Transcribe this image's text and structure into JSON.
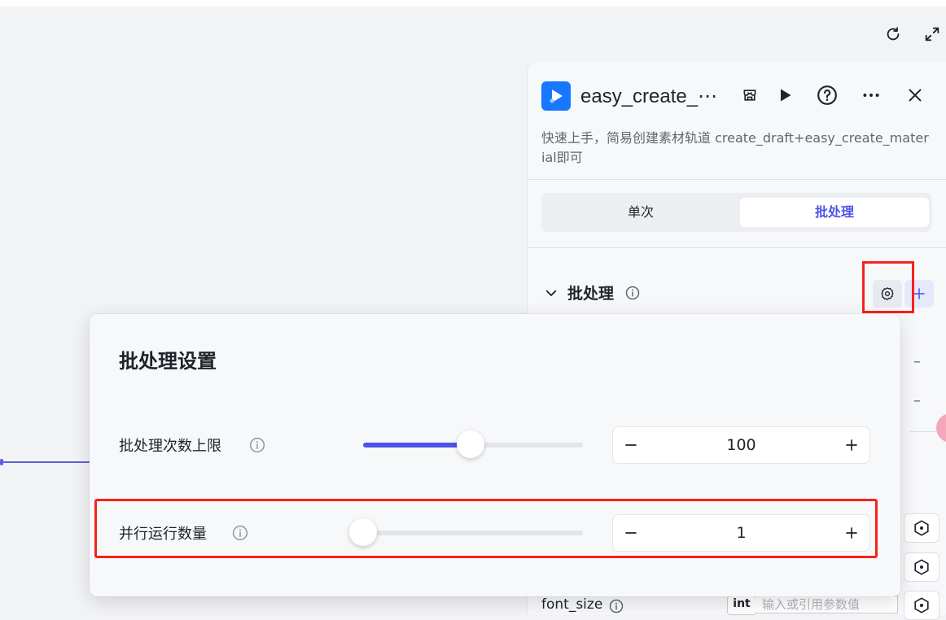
{
  "toolbar": {
    "refresh_icon": "refresh-icon",
    "fullscreen_icon": "expand-icon"
  },
  "panel": {
    "title": "easy_create_⋯",
    "description": "快速上手，简易创建素材轨道 create_draft+easy_create_material即可",
    "tabs": [
      {
        "label": "单次",
        "active": false
      },
      {
        "label": "批处理",
        "active": true
      }
    ],
    "section": {
      "title": "批处理"
    },
    "field": {
      "label": "font_size",
      "type_badge": "int",
      "placeholder": "输入或引用参数值"
    }
  },
  "popover": {
    "title": "批处理设置",
    "rows": [
      {
        "label": "批处理次数上限",
        "value": "100",
        "slider_fraction": 0.49
      },
      {
        "label": "并行运行数量",
        "value": "1",
        "slider_fraction": 0.0
      }
    ]
  },
  "colors": {
    "accent": "#4d53e8",
    "highlight": "#f5221b",
    "plugin_logo": "#1677ff"
  }
}
